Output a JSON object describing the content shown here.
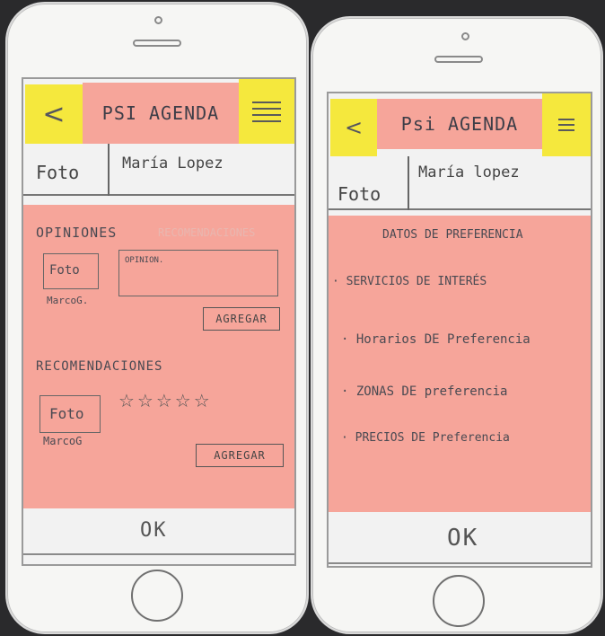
{
  "left": {
    "app_title": "PSI AGENDA",
    "foto": "Foto",
    "name": "María Lopez",
    "opiniones_heading": "OPINIONES",
    "recomendaciones_tab_faded": "RECOMENDACIONES",
    "opinion_photo": "Foto",
    "opinion_input_placeholder": "OPINION.",
    "opinion_user": "MarcoG.",
    "agregar_1": "AGREGAR",
    "recomendaciones_heading": "RECOMENDACIONES",
    "rec_photo": "Foto",
    "rating_stars": "☆☆☆☆☆",
    "rec_user": "MarcoG",
    "agregar_2": "AGREGAR",
    "ok": "OK"
  },
  "right": {
    "app_title": "Psi AGENDA",
    "foto": "Foto",
    "name": "María lopez",
    "section_title": "DATOS DE PREFERENCIA",
    "items": [
      "SERVICIOS DE INTERÉS",
      "Horarios DE Preferencia",
      "ZONAS DE preferencia",
      "PRECIOS DE Preferencia"
    ],
    "ok": "OK"
  },
  "colors": {
    "sticky_yellow": "#f5e83d",
    "sticky_pink": "#f6a59a"
  }
}
